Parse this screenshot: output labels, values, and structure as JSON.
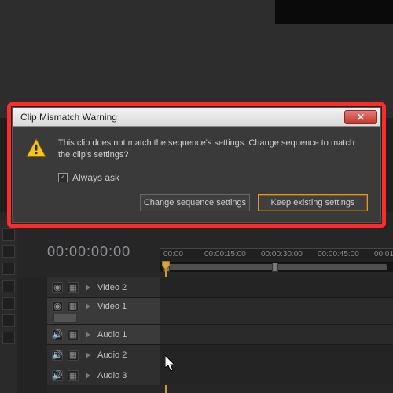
{
  "dialog": {
    "title": "Clip Mismatch Warning",
    "message": "This clip does not match the sequence's settings. Change sequence to match the clip's settings?",
    "always_ask_label": "Always ask",
    "always_ask_checked": true,
    "buttons": {
      "change": "Change sequence settings",
      "keep": "Keep existing settings"
    },
    "close_glyph": "✕"
  },
  "timeline": {
    "current_time": "00:00:00:00",
    "ruler_ticks": [
      "00:00",
      "00:00:15:00",
      "00:00:30:00",
      "00:00:45:00",
      "00:01"
    ],
    "tracks": {
      "v2": "Video 2",
      "v1": "Video 1",
      "a1": "Audio 1",
      "a2": "Audio 2",
      "a3": "Audio 3"
    }
  }
}
